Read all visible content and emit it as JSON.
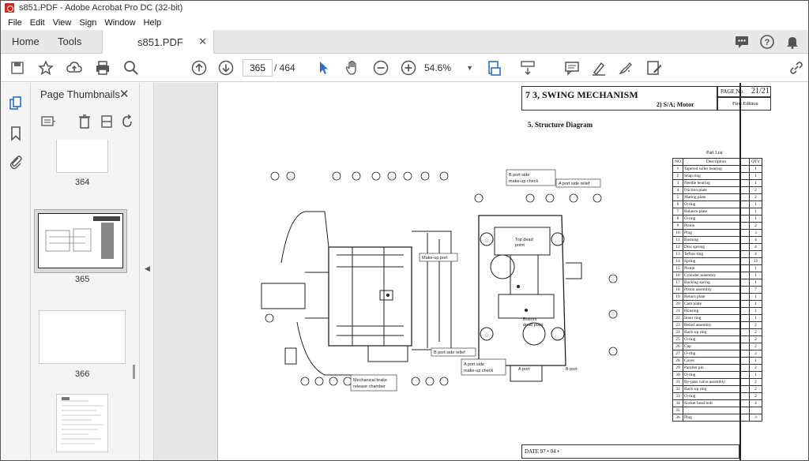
{
  "window": {
    "title": "s851.PDF - Adobe Acrobat Pro DC (32-bit)"
  },
  "menu": [
    "File",
    "Edit",
    "View",
    "Sign",
    "Window",
    "Help"
  ],
  "tabs": {
    "home": "Home",
    "tools": "Tools",
    "document": "s851.PDF"
  },
  "toolbar": {
    "current_page": "365",
    "page_total": "/ 464",
    "zoom": "54.6%"
  },
  "thumbnails": {
    "title": "Page Thumbnails",
    "pages": [
      {
        "label": "364"
      },
      {
        "label": "365",
        "selected": true
      },
      {
        "label": "366"
      }
    ]
  },
  "document": {
    "section": "7 3, SWING MECHANISM",
    "page_no_label": "PAGE No.",
    "page_no": "21/21",
    "subsection": "2)  S/A; Motor",
    "edition": "First Edition",
    "diagram_title": "5. Structure Diagram",
    "date_footer": "DATE  97 • 04 •",
    "labels": {
      "b_port_makeup": "B port side\nmake-up check",
      "a_port_relief": "A port side relief",
      "makeup_port": "Make-up port",
      "top_dead_point": "Top dead\npoint",
      "bottom_dead_point": "Bottom\ndead point",
      "b_port_relief": "B port side relief",
      "a_port_makeup": "A port side\nmake-up check",
      "a_port": "A port",
      "b_port": "B port",
      "mech_brake": "Mechanical brake\nrelease chamber"
    },
    "parts_list": {
      "title": "Part List",
      "headers": [
        "NO",
        "Description",
        "QTY"
      ],
      "rows": [
        [
          "1",
          "Tapered roller bearing",
          "1"
        ],
        [
          "2",
          "Snap ring",
          "1"
        ],
        [
          "3",
          "Needle bearing",
          "1"
        ],
        [
          "4",
          "Friction plate",
          "2"
        ],
        [
          "5",
          "Mating plate",
          "2"
        ],
        [
          "6",
          "O-ring",
          "1"
        ],
        [
          "7",
          "Balance plate",
          "1"
        ],
        [
          "8",
          "O-ring",
          "1"
        ],
        [
          "9",
          "Piston",
          "2"
        ],
        [
          "10",
          "Plug",
          "3"
        ],
        [
          "11",
          "Bushing",
          "4"
        ],
        [
          "12",
          "Disc sprong",
          "4"
        ],
        [
          "13",
          "Teflon ring",
          "4"
        ],
        [
          "14",
          "Spring",
          "12"
        ],
        [
          "15",
          "Piston",
          "1"
        ],
        [
          "16",
          "Cylinder assembly",
          "1"
        ],
        [
          "17",
          "Backing spring",
          "1"
        ],
        [
          "18",
          "Piston assembly",
          "7"
        ],
        [
          "19",
          "Return plate",
          "1"
        ],
        [
          "20",
          "Cam plate",
          "1"
        ],
        [
          "21",
          "Housing",
          "1"
        ],
        [
          "22",
          "Inner ring",
          "1"
        ],
        [
          "23",
          "Relief assembly",
          "2"
        ],
        [
          "24",
          "Back-up ring",
          "2"
        ],
        [
          "25",
          "O-ring",
          "2"
        ],
        [
          "26",
          "Cap",
          "2"
        ],
        [
          "27",
          "O-ring",
          "2"
        ],
        [
          "28",
          "Cover",
          "1"
        ],
        [
          "29",
          "Parallel pin",
          "2"
        ],
        [
          "30",
          "O-ring",
          "1"
        ],
        [
          "31",
          "By-pass valve assembly",
          "2"
        ],
        [
          "32",
          "Back-up ring",
          "2"
        ],
        [
          "33",
          "O-ring",
          "2"
        ],
        [
          "34",
          "Socket head bolt",
          "4"
        ],
        [
          "35",
          "",
          ""
        ],
        [
          "36",
          "Plug",
          "3"
        ]
      ]
    }
  }
}
